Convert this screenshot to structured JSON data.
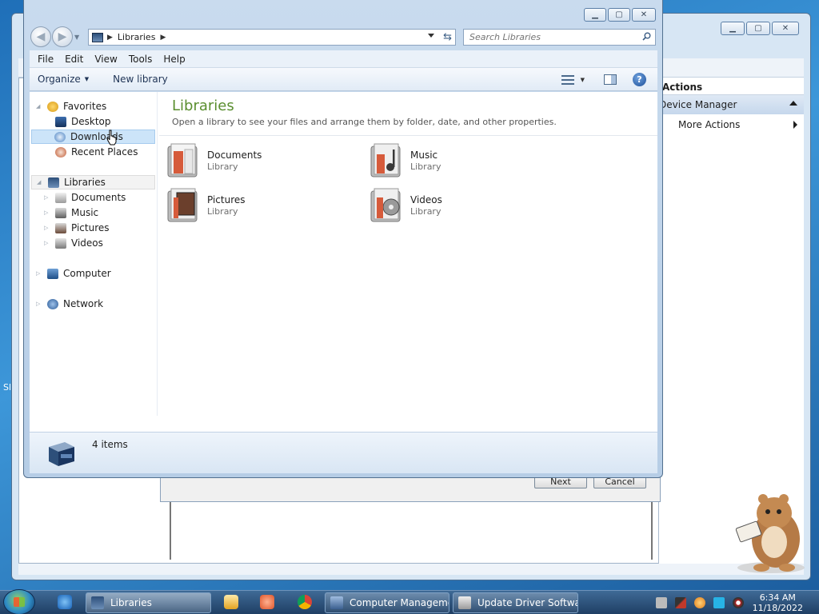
{
  "explorer": {
    "address": {
      "breadcrumb": "Libraries"
    },
    "search": {
      "placeholder": "Search Libraries"
    },
    "menu": [
      "File",
      "Edit",
      "View",
      "Tools",
      "Help"
    ],
    "commands": {
      "organize": "Organize",
      "new_library": "New library"
    },
    "nav": {
      "favorites": "Favorites",
      "desktop": "Desktop",
      "downloads": "Downloads",
      "recent_places": "Recent Places",
      "libraries": "Libraries",
      "documents": "Documents",
      "music": "Music",
      "pictures": "Pictures",
      "videos": "Videos",
      "computer": "Computer",
      "network": "Network"
    },
    "content": {
      "title": "Libraries",
      "subtitle": "Open a library to see your files and arrange them by folder, date, and other properties.",
      "items": [
        {
          "name": "Documents",
          "type": "Library",
          "icon": "documents-library-icon"
        },
        {
          "name": "Music",
          "type": "Library",
          "icon": "music-library-icon"
        },
        {
          "name": "Pictures",
          "type": "Library",
          "icon": "pictures-library-icon"
        },
        {
          "name": "Videos",
          "type": "Library",
          "icon": "videos-library-icon"
        }
      ]
    },
    "details": {
      "count_text": "4 items"
    }
  },
  "background_window": {
    "actions_header": "Actions",
    "actions_sub": "Device Manager",
    "more_actions": "More Actions"
  },
  "wizard": {
    "next": "Next",
    "cancel": "Cancel"
  },
  "taskbar": {
    "items": [
      "Libraries",
      "Computer Manageme...",
      "Update Driver Softwa..."
    ],
    "time": "6:34 AM",
    "date": "11/18/2022"
  },
  "colors": {
    "accent_green": "#5a8e2f",
    "selection": "#cce4f9",
    "taskbar": "#2b5078"
  }
}
